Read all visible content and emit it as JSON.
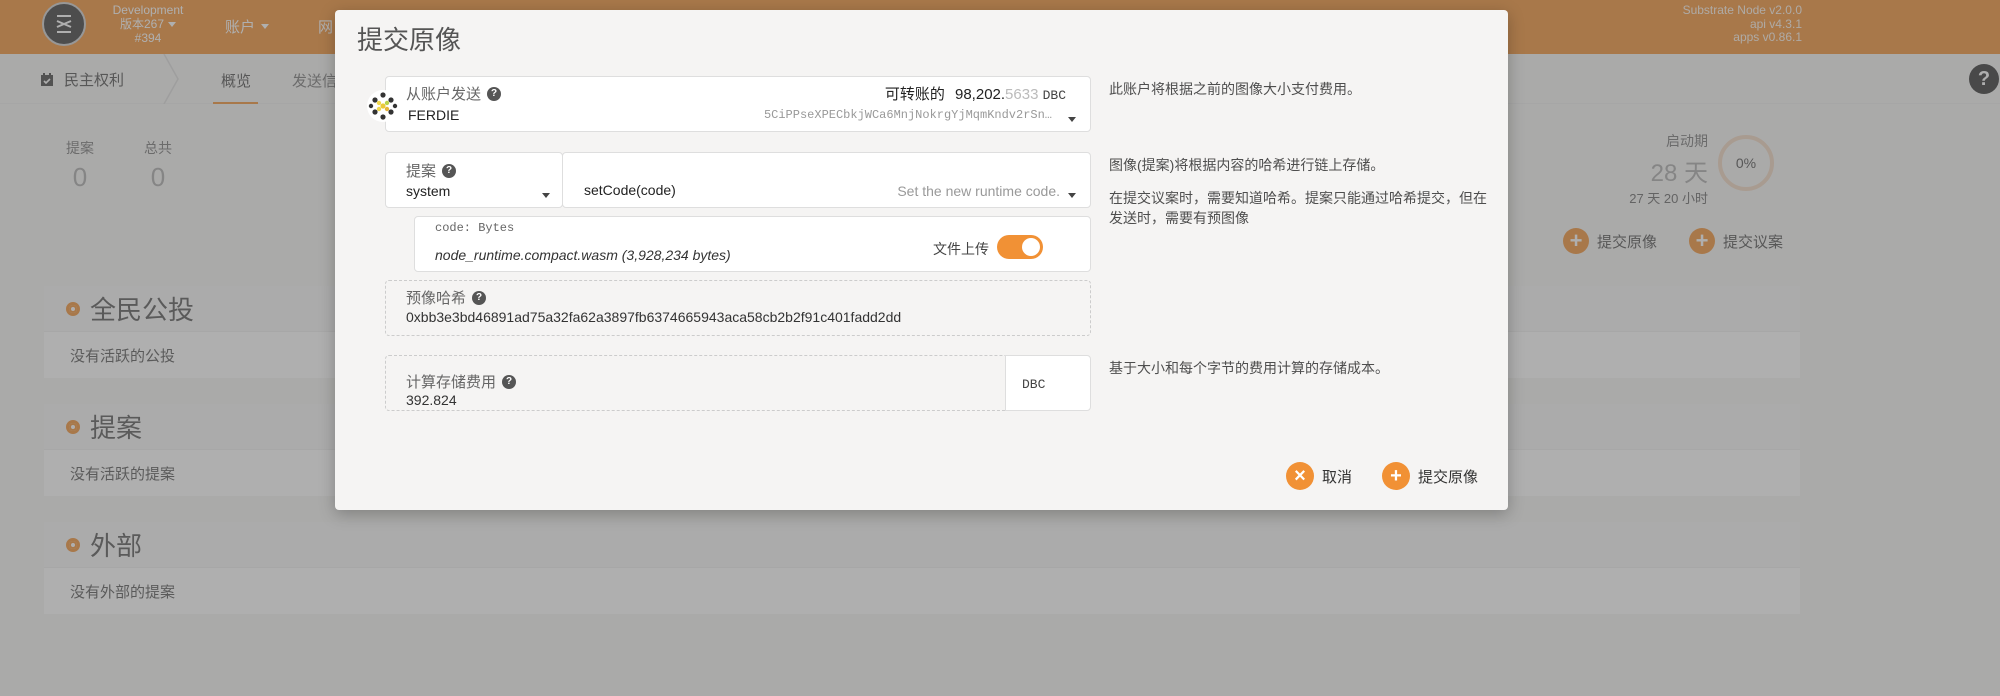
{
  "header": {
    "chain_name": "Development",
    "chain_version": "版本267",
    "block": "#394",
    "nav": [
      {
        "label": "账户"
      },
      {
        "label": "网"
      }
    ],
    "node_info": [
      "Substrate Node v2.0.0",
      "api v4.3.1",
      "apps v0.86.1"
    ]
  },
  "subnav": {
    "section": "民主权利",
    "tabs": [
      {
        "label": "概览"
      },
      {
        "label": "发送信"
      }
    ]
  },
  "stats": {
    "proposals": {
      "label": "提案",
      "value": "0"
    },
    "total": {
      "label": "总共",
      "value": "0"
    },
    "launch_period": {
      "label": "启动期",
      "value": "28 天",
      "sub": "27 天 20 小时",
      "percent": "0%"
    }
  },
  "actions": {
    "submit_preimage": "提交原像",
    "submit_proposal": "提交议案"
  },
  "panels": [
    {
      "title": "全民公投",
      "empty": "没有活跃的公投"
    },
    {
      "title": "提案",
      "empty": "没有活跃的提案"
    },
    {
      "title": "外部",
      "empty": "没有外部的提案"
    }
  ],
  "modal": {
    "title": "提交原像",
    "from_account": {
      "label": "从账户发送",
      "transferable_label": "可转账的",
      "balance_main": "98,202.",
      "balance_decimals": "5633",
      "unit": "DBC",
      "name": "FERDIE",
      "address": "5CiPPseXPECbkjWCa6MnjNokrgYjMqmKndv2rSn…",
      "help": "此账户将根据之前的图像大小支付费用。"
    },
    "proposal": {
      "label": "提案",
      "module": "system",
      "method": "setCode(code)",
      "method_desc": "Set the new runtime code.",
      "help_1": "图像(提案)将根据内容的哈希进行链上存储。",
      "help_2": "在提交议案时，需要知道哈希。提案只能通过哈希提交，但在发送时，需要有预图像"
    },
    "code_param": {
      "label": "code: Bytes",
      "file": "node_runtime.compact.wasm (3,928,234 bytes)",
      "upload_label": "文件上传",
      "upload_enabled": true
    },
    "preimage_hash": {
      "label": "预像哈希",
      "value": "0xbb3e3bd46891ad75a32fa62a3897fb6374665943aca58cb2b2f91c401fadd2dd"
    },
    "storage_fee": {
      "label": "计算存储费用",
      "value": "392.824",
      "unit": "DBC",
      "help": "基于大小和每个字节的费用计算的存储成本。"
    },
    "buttons": {
      "cancel": "取消",
      "submit": "提交原像"
    }
  },
  "colors": {
    "accent": "#f19135",
    "overlay": "rgba(96,96,96,0.5)"
  }
}
